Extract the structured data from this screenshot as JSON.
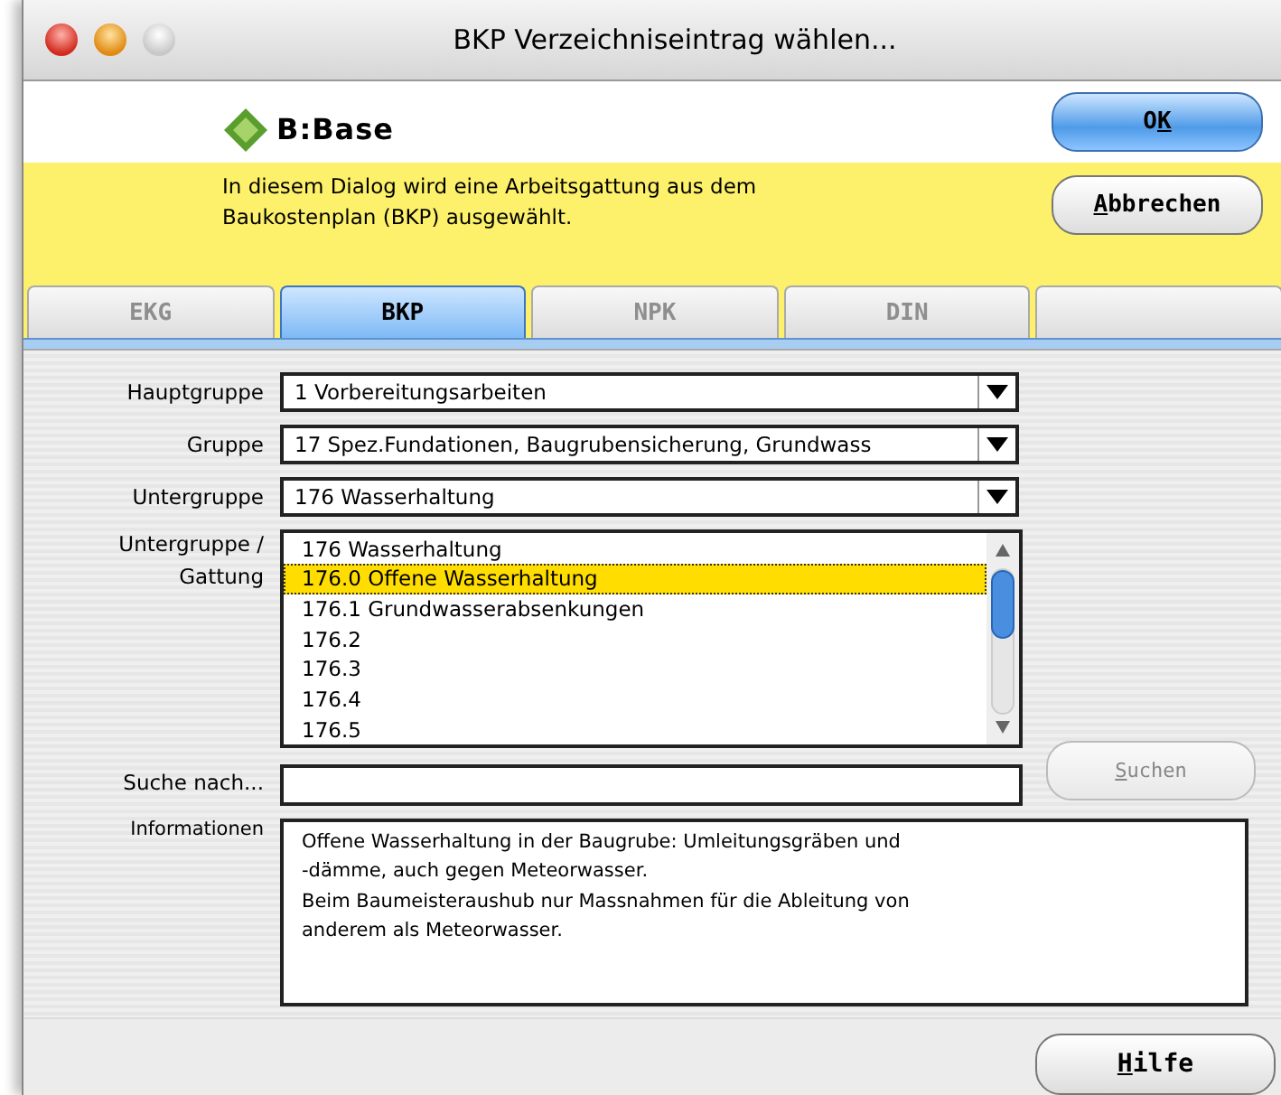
{
  "window": {
    "title": "BKP Verzeichniseintrag wählen..."
  },
  "header": {
    "logo_text": "B:Base",
    "description": "In diesem Dialog wird eine Arbeitsgattung aus dem Baukostenplan (BKP) ausgewählt."
  },
  "buttons": [
    {
      "pre": "O",
      "key": "K",
      "kind": "default"
    },
    {
      "key": "A",
      "post": "bbrechen",
      "kind": "normal"
    }
  ],
  "tabs": [
    {
      "label": "EKG",
      "selected": false,
      "disabled": true
    },
    {
      "label": "BKP",
      "selected": true,
      "disabled": false
    },
    {
      "label": "NPK",
      "selected": false,
      "disabled": true
    },
    {
      "label": "DIN",
      "selected": false,
      "disabled": true
    },
    {
      "selected": false
    }
  ],
  "dropdowns": [
    {
      "label": "Hauptgruppe",
      "value": "1 Vorbereitungsarbeiten"
    },
    {
      "label": "Gruppe",
      "value": "17 Spez.Fundationen, Baugrubensicherung, Grundwass"
    },
    {
      "label": "Untergruppe",
      "value": "176 Wasserhaltung"
    }
  ],
  "list": {
    "label_lines": [
      "Untergruppe /",
      "Gattung"
    ],
    "items": [
      {
        "text": "176 Wasserhaltung",
        "selected": false
      },
      {
        "text": "176.0 Offene Wasserhaltung",
        "selected": true
      },
      {
        "text": "176.1 Grundwasserabsenkungen",
        "selected": false
      },
      {
        "text": "176.2",
        "selected": false
      },
      {
        "text": "176.3",
        "selected": false
      },
      {
        "text": "176.4",
        "selected": false
      },
      {
        "text": "176.5",
        "selected": false
      }
    ]
  },
  "search": {
    "label": "Suche nach...",
    "button": {
      "key": "S",
      "post": "uchen",
      "disabled": true
    }
  },
  "info": {
    "label": "Informationen",
    "lines": [
      "Offene Wasserhaltung in der Baugrube: Umleitungsgräben und",
      "-dämme, auch gegen Meteorwasser.",
      "Beim Baumeisteraushub nur Massnahmen für die Ableitung von",
      "anderem als Meteorwasser."
    ]
  },
  "help_button": {
    "key": "H",
    "post": "ilfe"
  }
}
